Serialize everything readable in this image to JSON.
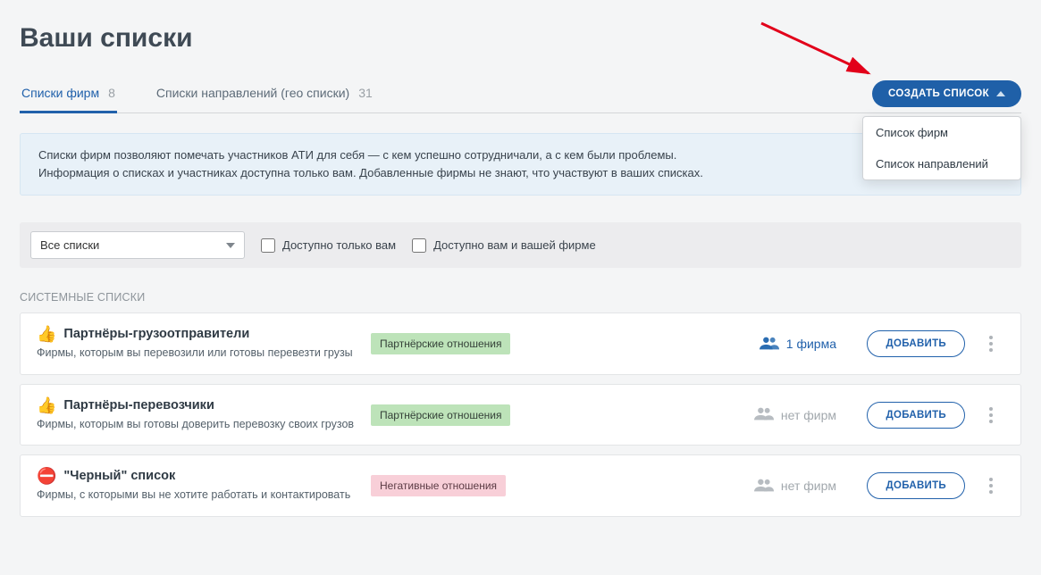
{
  "page_title": "Ваши списки",
  "tabs": [
    {
      "label": "Списки фирм",
      "count": "8",
      "active": true
    },
    {
      "label": "Списки направлений (гео списки)",
      "count": "31",
      "active": false
    }
  ],
  "create_button": "СОЗДАТЬ СПИСОК",
  "create_dropdown": [
    {
      "label": "Список фирм"
    },
    {
      "label": "Список направлений"
    }
  ],
  "info": {
    "line1": "Списки фирм позволяют помечать участников АТИ для себя — с кем успешно сотрудничали, а с кем были проблемы.",
    "line2": "Информация о списках и участниках доступна только вам. Добавленные фирмы не знают, что участвуют в ваших списках."
  },
  "filter": {
    "select_label": "Все списки",
    "only_me": "Доступно только вам",
    "me_and_firm": "Доступно вам и вашей фирме"
  },
  "group_title": "СИСТЕМНЫЕ СПИСКИ",
  "add_button_label": "ДОБАВИТЬ",
  "lists": [
    {
      "icon": "👍",
      "title": "Партнёры-грузоотправители",
      "desc": "Фирмы, которым вы перевозили или готовы перевезти грузы",
      "tag": {
        "text": "Партнёрские отношения",
        "style": "green"
      },
      "firms": {
        "text": "1 фирма",
        "active": true
      }
    },
    {
      "icon": "👍",
      "title": "Партнёры-перевозчики",
      "desc": "Фирмы, которым вы готовы доверить перевозку своих грузов",
      "tag": {
        "text": "Партнёрские отношения",
        "style": "green"
      },
      "firms": {
        "text": "нет фирм",
        "active": false
      }
    },
    {
      "icon": "⛔",
      "title": "\"Черный\" список",
      "desc": "Фирмы, с которыми вы не хотите работать и контактировать",
      "tag": {
        "text": "Негативные отношения",
        "style": "red"
      },
      "firms": {
        "text": "нет фирм",
        "active": false
      }
    }
  ]
}
